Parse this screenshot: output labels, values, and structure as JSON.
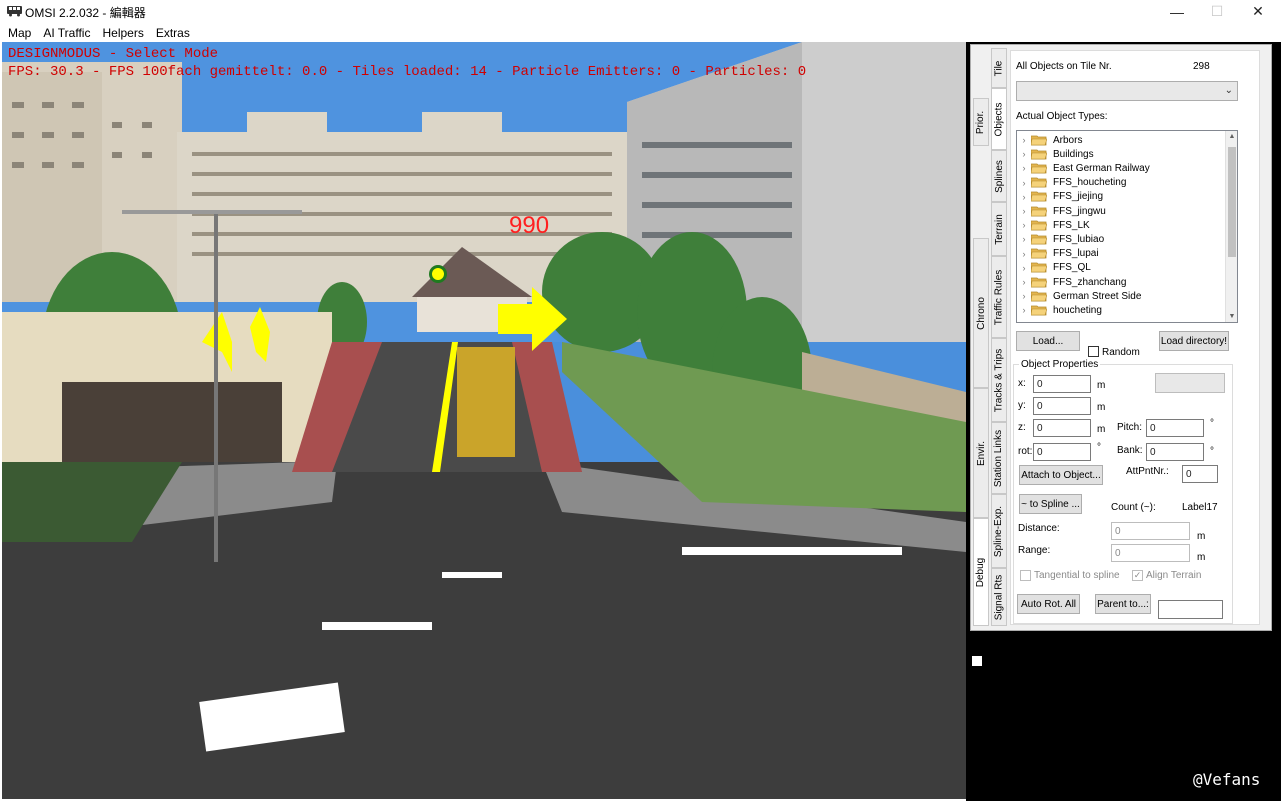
{
  "window": {
    "title": "OMSI 2.2.032 - 編輯器",
    "controls": {
      "minimize": "—",
      "maximize": "☐",
      "close": "✕"
    }
  },
  "menu": [
    "Map",
    "AI Traffic",
    "Helpers",
    "Extras"
  ],
  "viewport": {
    "mode_line": "DESIGNMODUS - Select Mode",
    "stats_line": "FPS: 30.3 - FPS 100fach gemittelt: 0.0 - Tiles loaded: 14 - Particle Emitters: 0 - Particles: 0",
    "distance_label": "990",
    "accent_overlay_color": "#d00000",
    "arrow_color": "#ffff00"
  },
  "tabs_outer": [
    "Prior.",
    "Chrono",
    "Envir.",
    "Debug"
  ],
  "tabs_inner": [
    "Tile",
    "Objects",
    "Splines",
    "Terrain",
    "Traffic Rules",
    "Tracks & Trips",
    "Station Links",
    "Spline-Exp.",
    "Signal Rts"
  ],
  "objects_panel": {
    "all_objects_label": "All Objects on Tile Nr.",
    "object_count": "298",
    "object_types_label": "Actual Object Types:",
    "object_types": [
      "Arbors",
      "Buildings",
      "East German Railway",
      "FFS_houcheting",
      "FFS_jiejing",
      "FFS_jingwu",
      "FFS_LK",
      "FFS_lubiao",
      "FFS_lupai",
      "FFS_QL",
      "FFS_zhanchang",
      "German Street Side",
      "houcheting"
    ],
    "load_button": "Load...",
    "random_label": "Random",
    "load_directory_button": "Load directory!",
    "properties_title": "Object Properties",
    "x_label": "x:",
    "x_value": "0",
    "x_unit": "m",
    "y_label": "y:",
    "y_value": "0",
    "y_unit": "m",
    "z_label": "z:",
    "z_value": "0",
    "z_unit": "m",
    "pitch_label": "Pitch:",
    "pitch_value": "0",
    "pitch_unit": "°",
    "rot_label": "rot:",
    "rot_value": "0",
    "rot_unit": "°",
    "bank_label": "Bank:",
    "bank_value": "0",
    "bank_unit": "°",
    "attach_button": "Attach to Object...",
    "attpnt_label": "AttPntNr.:",
    "attpnt_value": "0",
    "to_spline_button": "~ to Spline ...",
    "count_label": "Count (~):",
    "count_value": "Label17",
    "distance_label": "Distance:",
    "distance_value": "0",
    "distance_unit": "m",
    "range_label": "Range:",
    "range_value": "0",
    "range_unit": "m",
    "tangential_label": "Tangential to spline",
    "align_terrain_label": "Align Terrain",
    "auto_rot_button": "Auto Rot. All",
    "parent_button": "Parent to...:"
  },
  "watermark": "@Vefans"
}
